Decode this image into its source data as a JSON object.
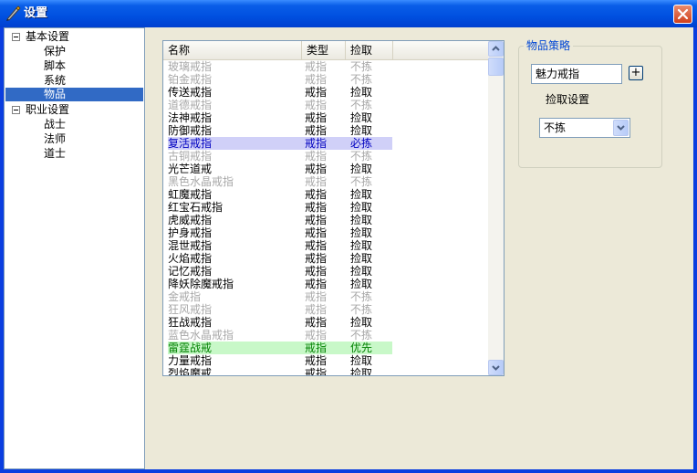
{
  "window": {
    "title": "设置"
  },
  "icons": {
    "app": "pen-icon",
    "close": "close-icon",
    "tree_expander": "minus-box-icon",
    "scroll_up": "arrow-up-icon",
    "scroll_down": "arrow-down-icon",
    "dropdown": "chevron-down-icon"
  },
  "tree": {
    "groups": [
      {
        "label": "基本设置",
        "children": [
          "保护",
          "脚本",
          "系统",
          "物品"
        ]
      },
      {
        "label": "职业设置",
        "children": [
          "战士",
          "法师",
          "道士"
        ]
      }
    ],
    "selected": "物品"
  },
  "list": {
    "columns": [
      "名称",
      "类型",
      "捡取"
    ],
    "rows": [
      {
        "name": "玻璃戒指",
        "type": "戒指",
        "pick": "不拣",
        "state": "disabled"
      },
      {
        "name": "铂金戒指",
        "type": "戒指",
        "pick": "不拣",
        "state": "disabled"
      },
      {
        "name": "传送戒指",
        "type": "戒指",
        "pick": "捡取",
        "state": "normal"
      },
      {
        "name": "道德戒指",
        "type": "戒指",
        "pick": "不拣",
        "state": "disabled"
      },
      {
        "name": "法神戒指",
        "type": "戒指",
        "pick": "捡取",
        "state": "normal"
      },
      {
        "name": "防御戒指",
        "type": "戒指",
        "pick": "捡取",
        "state": "normal"
      },
      {
        "name": "复活戒指",
        "type": "戒指",
        "pick": "必拣",
        "state": "must"
      },
      {
        "name": "古铜戒指",
        "type": "戒指",
        "pick": "不拣",
        "state": "disabled"
      },
      {
        "name": "光芒道戒",
        "type": "戒指",
        "pick": "捡取",
        "state": "normal"
      },
      {
        "name": "黑色水晶戒指",
        "type": "戒指",
        "pick": "不拣",
        "state": "disabled"
      },
      {
        "name": "虹魔戒指",
        "type": "戒指",
        "pick": "捡取",
        "state": "normal"
      },
      {
        "name": "红宝石戒指",
        "type": "戒指",
        "pick": "捡取",
        "state": "normal"
      },
      {
        "name": "虎威戒指",
        "type": "戒指",
        "pick": "捡取",
        "state": "normal"
      },
      {
        "name": "护身戒指",
        "type": "戒指",
        "pick": "捡取",
        "state": "normal"
      },
      {
        "name": "混世戒指",
        "type": "戒指",
        "pick": "捡取",
        "state": "normal"
      },
      {
        "name": "火焰戒指",
        "type": "戒指",
        "pick": "捡取",
        "state": "normal"
      },
      {
        "name": "记忆戒指",
        "type": "戒指",
        "pick": "捡取",
        "state": "normal"
      },
      {
        "name": "降妖除魔戒指",
        "type": "戒指",
        "pick": "捡取",
        "state": "normal"
      },
      {
        "name": "金戒指",
        "type": "戒指",
        "pick": "不拣",
        "state": "disabled"
      },
      {
        "name": "狂风戒指",
        "type": "戒指",
        "pick": "不拣",
        "state": "disabled"
      },
      {
        "name": "狂战戒指",
        "type": "戒指",
        "pick": "捡取",
        "state": "normal"
      },
      {
        "name": "蓝色水晶戒指",
        "type": "戒指",
        "pick": "不拣",
        "state": "disabled"
      },
      {
        "name": "雷霆战戒",
        "type": "戒指",
        "pick": "优先",
        "state": "priority"
      },
      {
        "name": "力量戒指",
        "type": "戒指",
        "pick": "捡取",
        "state": "normal"
      },
      {
        "name": "烈焰魔戒",
        "type": "戒指",
        "pick": "捡取",
        "state": "normal"
      }
    ]
  },
  "strategy": {
    "group_title": "物品策略",
    "item_name": "魅力戒指",
    "add_label": "+",
    "pickup_label": "捡取设置",
    "pickup_value": "不拣"
  },
  "colors": {
    "accent": "#316ac5",
    "must_bg": "#d0d0f8",
    "priority_bg": "#c8f8c8",
    "disabled_text": "#a8a8a8"
  }
}
